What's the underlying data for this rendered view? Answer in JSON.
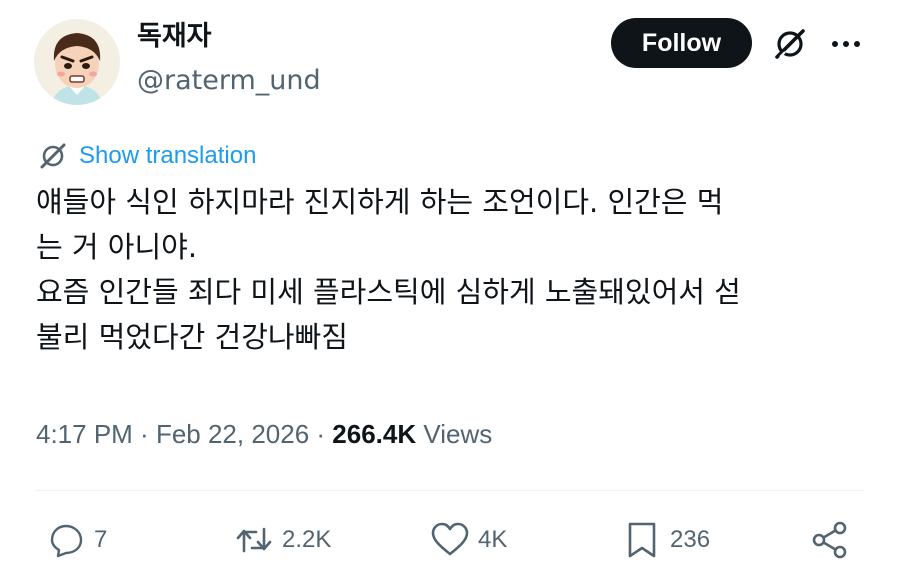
{
  "author": {
    "display_name": "독재자",
    "handle": "@raterm_und"
  },
  "header": {
    "follow_label": "Follow"
  },
  "translation": {
    "label": "Show translation"
  },
  "tweet": {
    "lines": [
      "얘들아 식인 하지마라 진지하게 하는 조언이다. 인간은 먹",
      "는 거 아니야.",
      "요즘 인간들 죄다 미세 플라스틱에 심하게 노출돼있어서 섣",
      "불리 먹었다간 건강나빠짐"
    ]
  },
  "meta": {
    "time": "4:17 PM",
    "separator": " · ",
    "date": "Feb 22, 2026",
    "views_count": "266.4K",
    "views_label": "Views"
  },
  "actions": {
    "replies": "7",
    "reposts": "2.2K",
    "likes": "4K",
    "bookmarks": "236"
  },
  "icons": {
    "grok": "grok-icon",
    "more": "more-dots-icon",
    "reply": "reply-icon",
    "repost": "repost-icon",
    "like": "heart-icon",
    "bookmark": "bookmark-icon",
    "share": "share-icon"
  },
  "colors": {
    "text_primary": "#0f1419",
    "text_secondary": "#536471",
    "link": "#1d9bf0",
    "follow_bg": "#0f1419"
  }
}
